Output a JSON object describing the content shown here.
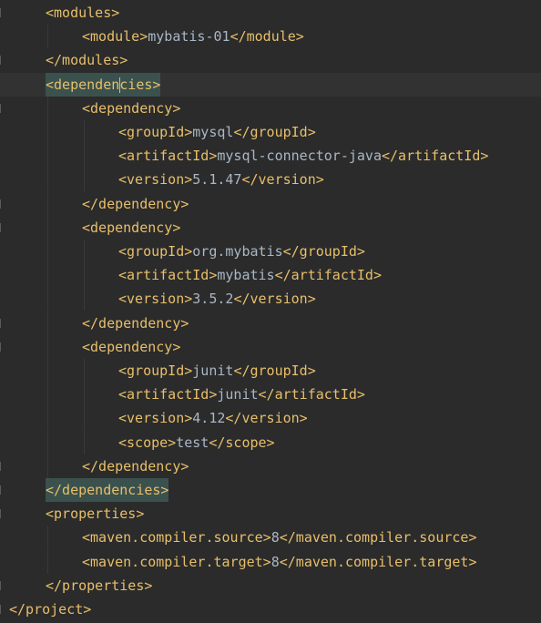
{
  "editor": {
    "lines": [
      {
        "indent": 1,
        "parts": [
          {
            "t": "<modules>"
          }
        ]
      },
      {
        "indent": 2,
        "parts": [
          {
            "t": "<module>"
          },
          {
            "x": "mybatis-01"
          },
          {
            "t": "</module>"
          }
        ]
      },
      {
        "indent": 1,
        "parts": [
          {
            "t": "</modules>"
          }
        ]
      },
      {
        "indent": 1,
        "current": true,
        "highlight": true,
        "parts": [
          {
            "t": "<dependen"
          },
          {
            "caret": true
          },
          {
            "t": "cies>"
          }
        ]
      },
      {
        "indent": 2,
        "parts": [
          {
            "t": "<dependency>"
          }
        ]
      },
      {
        "indent": 3,
        "parts": [
          {
            "t": "<groupId>"
          },
          {
            "x": "mysql"
          },
          {
            "t": "</groupId>"
          }
        ]
      },
      {
        "indent": 3,
        "parts": [
          {
            "t": "<artifactId>"
          },
          {
            "x": "mysql-connector-java"
          },
          {
            "t": "</artifactId>"
          }
        ]
      },
      {
        "indent": 3,
        "parts": [
          {
            "t": "<version>"
          },
          {
            "x": "5.1.47"
          },
          {
            "t": "</version>"
          }
        ]
      },
      {
        "indent": 2,
        "parts": [
          {
            "t": "</dependency>"
          }
        ]
      },
      {
        "indent": 2,
        "parts": [
          {
            "t": "<dependency>"
          }
        ]
      },
      {
        "indent": 3,
        "parts": [
          {
            "t": "<groupId>"
          },
          {
            "x": "org.mybatis"
          },
          {
            "t": "</groupId>"
          }
        ]
      },
      {
        "indent": 3,
        "parts": [
          {
            "t": "<artifactId>"
          },
          {
            "x": "mybatis"
          },
          {
            "t": "</artifactId>"
          }
        ]
      },
      {
        "indent": 3,
        "parts": [
          {
            "t": "<version>"
          },
          {
            "x": "3.5.2"
          },
          {
            "t": "</version>"
          }
        ]
      },
      {
        "indent": 2,
        "parts": [
          {
            "t": "</dependency>"
          }
        ]
      },
      {
        "indent": 2,
        "parts": [
          {
            "t": "<dependency>"
          }
        ]
      },
      {
        "indent": 3,
        "parts": [
          {
            "t": "<groupId>"
          },
          {
            "x": "junit"
          },
          {
            "t": "</groupId>"
          }
        ]
      },
      {
        "indent": 3,
        "parts": [
          {
            "t": "<artifactId>"
          },
          {
            "x": "junit"
          },
          {
            "t": "</artifactId>"
          }
        ]
      },
      {
        "indent": 3,
        "parts": [
          {
            "t": "<version>"
          },
          {
            "x": "4.12"
          },
          {
            "t": "</version>"
          }
        ]
      },
      {
        "indent": 3,
        "parts": [
          {
            "t": "<scope>"
          },
          {
            "x": "test"
          },
          {
            "t": "</scope>"
          }
        ]
      },
      {
        "indent": 2,
        "parts": [
          {
            "t": "</dependency>"
          }
        ]
      },
      {
        "indent": 1,
        "highlight": true,
        "parts": [
          {
            "t": "</dependencies>"
          }
        ]
      },
      {
        "indent": 1,
        "parts": [
          {
            "t": "<properties>"
          }
        ]
      },
      {
        "indent": 2,
        "parts": [
          {
            "t": "<maven.compiler.source>"
          },
          {
            "x": "8"
          },
          {
            "t": "</maven.compiler.source>"
          }
        ]
      },
      {
        "indent": 2,
        "parts": [
          {
            "t": "<maven.compiler.target>"
          },
          {
            "x": "8"
          },
          {
            "t": "</maven.compiler.target>"
          }
        ]
      },
      {
        "indent": 1,
        "parts": [
          {
            "t": "</properties>"
          }
        ]
      },
      {
        "indent": 0,
        "parts": [
          {
            "t": "</project>"
          }
        ]
      }
    ]
  },
  "gutter": {
    "intention_icon": "lightbulb-icon"
  },
  "colors": {
    "background": "#2b2b2b",
    "tag": "#e8bf6a",
    "text": "#a9b7c6",
    "bracket_match": "#3b514d",
    "current_line": "#323232"
  }
}
